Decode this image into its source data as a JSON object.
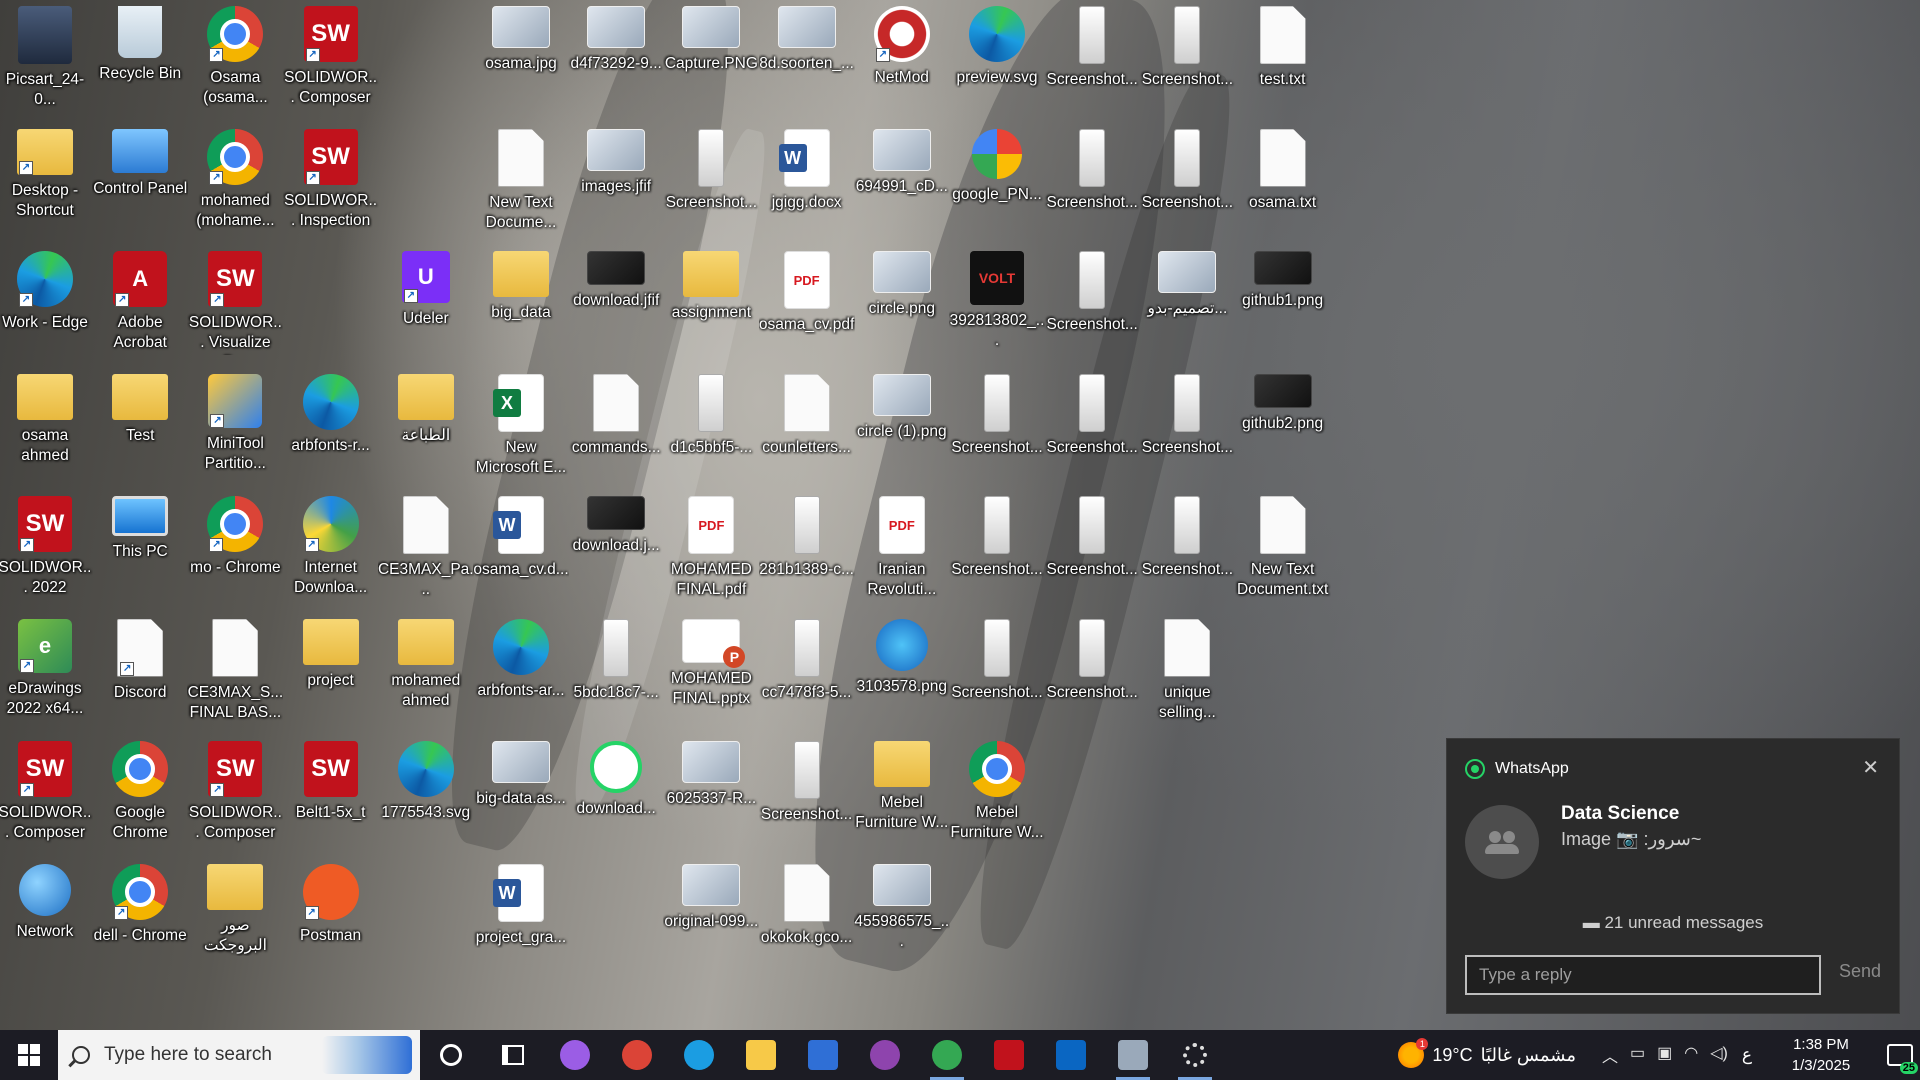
{
  "desktop": {
    "icons": [
      {
        "label": "Picsart_24-0...",
        "kind": "person",
        "col": 0,
        "row": 0
      },
      {
        "label": "Desktop - Shortcut",
        "kind": "folder",
        "col": 0,
        "row": 1,
        "shortcut": true
      },
      {
        "label": "Work - Edge",
        "kind": "edge",
        "col": 0,
        "row": 2,
        "shortcut": true
      },
      {
        "label": "osama ahmed",
        "kind": "folder",
        "col": 0,
        "row": 3
      },
      {
        "label": "SOLIDWOR... 2022",
        "kind": "sw",
        "col": 0,
        "row": 4,
        "shortcut": true
      },
      {
        "label": "eDrawings 2022 x64...",
        "kind": "edraw",
        "col": 0,
        "row": 5,
        "shortcut": true
      },
      {
        "label": "SOLIDWOR... Composer ...",
        "kind": "sw",
        "col": 0,
        "row": 6,
        "shortcut": true
      },
      {
        "label": "Network",
        "kind": "net",
        "col": 0,
        "row": 7
      },
      {
        "label": "Recycle Bin",
        "kind": "bin",
        "col": 1,
        "row": 0
      },
      {
        "label": "Control Panel",
        "kind": "cpanel",
        "col": 1,
        "row": 1
      },
      {
        "label": "Adobe Acrobat",
        "kind": "acrobat",
        "col": 1,
        "row": 2,
        "shortcut": true
      },
      {
        "label": "Test",
        "kind": "folder",
        "col": 1,
        "row": 3
      },
      {
        "label": "This PC",
        "kind": "pc",
        "col": 1,
        "row": 4
      },
      {
        "label": "Discord",
        "kind": "file",
        "col": 1,
        "row": 5,
        "shortcut": true
      },
      {
        "label": "Google Chrome",
        "kind": "chrome",
        "col": 1,
        "row": 6
      },
      {
        "label": "dell - Chrome",
        "kind": "chrome",
        "col": 1,
        "row": 7,
        "shortcut": true
      },
      {
        "label": "Osama (osama...",
        "kind": "chrome",
        "col": 2,
        "row": 0,
        "shortcut": true
      },
      {
        "label": "mohamed (mohame...",
        "kind": "chrome",
        "col": 2,
        "row": 1,
        "shortcut": true
      },
      {
        "label": "SOLIDWOR... Visualize B...",
        "kind": "sw",
        "col": 2,
        "row": 2,
        "shortcut": true
      },
      {
        "label": "MiniTool Partitio...",
        "kind": "minitool",
        "col": 2,
        "row": 3,
        "shortcut": true
      },
      {
        "label": "mo - Chrome",
        "kind": "chrome",
        "col": 2,
        "row": 4,
        "shortcut": true
      },
      {
        "label": "CE3MAX_S... FINAL BAS...",
        "kind": "file",
        "col": 2,
        "row": 5
      },
      {
        "label": "SOLIDWOR... Composer ...",
        "kind": "sw",
        "col": 2,
        "row": 6,
        "shortcut": true
      },
      {
        "label": "صور البروجكت",
        "kind": "folder",
        "col": 2,
        "row": 7
      },
      {
        "label": "SOLIDWOR... Composer ...",
        "kind": "sw",
        "col": 3,
        "row": 0,
        "shortcut": true
      },
      {
        "label": "SOLIDWOR... Inspection ...",
        "kind": "sw",
        "col": 3,
        "row": 1,
        "shortcut": true
      },
      {
        "label": "arbfonts-r...",
        "kind": "edge",
        "col": 3,
        "row": 3
      },
      {
        "label": "Internet Downloa...",
        "kind": "idm",
        "col": 3,
        "row": 4,
        "shortcut": true
      },
      {
        "label": "project",
        "kind": "folder",
        "col": 3,
        "row": 5
      },
      {
        "label": "Belt1-5x_t",
        "kind": "sw",
        "col": 3,
        "row": 6
      },
      {
        "label": "Postman",
        "kind": "postman",
        "col": 3,
        "row": 7,
        "shortcut": true
      },
      {
        "label": "Udeler",
        "kind": "udeler",
        "col": 4,
        "row": 2,
        "shortcut": true
      },
      {
        "label": "الطباعة",
        "kind": "folder",
        "col": 4,
        "row": 3
      },
      {
        "label": "CE3MAX_Pa...",
        "kind": "file",
        "col": 4,
        "row": 4
      },
      {
        "label": "mohamed ahmed",
        "kind": "folder",
        "col": 4,
        "row": 5
      },
      {
        "label": "1775543.svg",
        "kind": "edge",
        "col": 4,
        "row": 6
      },
      {
        "label": "osama.jpg",
        "kind": "image",
        "col": 5,
        "row": 0
      },
      {
        "label": "New Text Docume...",
        "kind": "file",
        "col": 5,
        "row": 1
      },
      {
        "label": "big_data",
        "kind": "folder",
        "col": 5,
        "row": 2
      },
      {
        "label": "New Microsoft E...",
        "kind": "excel",
        "col": 5,
        "row": 3
      },
      {
        "label": "osama_cv.d...",
        "kind": "word",
        "col": 5,
        "row": 4
      },
      {
        "label": "arbfonts-ar...",
        "kind": "edge",
        "col": 5,
        "row": 5
      },
      {
        "label": "big-data.as...",
        "kind": "image",
        "col": 5,
        "row": 6
      },
      {
        "label": "project_gra...",
        "kind": "word",
        "col": 5,
        "row": 7
      },
      {
        "label": "d4f73292-9...",
        "kind": "image",
        "col": 6,
        "row": 0
      },
      {
        "label": "images.jfif",
        "kind": "image",
        "col": 6,
        "row": 1
      },
      {
        "label": "download.jfif",
        "kind": "image-dark",
        "col": 6,
        "row": 2
      },
      {
        "label": "commands...",
        "kind": "file",
        "col": 6,
        "row": 3
      },
      {
        "label": "download.j...",
        "kind": "image-dark",
        "col": 6,
        "row": 4
      },
      {
        "label": "5bdc18c7-...",
        "kind": "phone",
        "col": 6,
        "row": 5
      },
      {
        "label": "download...",
        "kind": "whats",
        "col": 6,
        "row": 6
      },
      {
        "label": "Capture.PNG",
        "kind": "image",
        "col": 7,
        "row": 0
      },
      {
        "label": "Screenshot...",
        "kind": "phone",
        "col": 7,
        "row": 1
      },
      {
        "label": "assignment",
        "kind": "folder",
        "col": 7,
        "row": 2
      },
      {
        "label": "d1c5bbf5-...",
        "kind": "phone",
        "col": 7,
        "row": 3
      },
      {
        "label": "MOHAMED FINAL.pdf",
        "kind": "pdf",
        "col": 7,
        "row": 4
      },
      {
        "label": "MOHAMED FINAL.pptx",
        "kind": "ppt",
        "col": 7,
        "row": 5
      },
      {
        "label": "6025337-R...",
        "kind": "image",
        "col": 7,
        "row": 6
      },
      {
        "label": "original-099...",
        "kind": "image",
        "col": 7,
        "row": 7
      },
      {
        "label": "8d.soorten_...",
        "kind": "image",
        "col": 8,
        "row": 0
      },
      {
        "label": "jgigg.docx",
        "kind": "word",
        "col": 8,
        "row": 1
      },
      {
        "label": "osama_cv.pdf",
        "kind": "pdf",
        "col": 8,
        "row": 2
      },
      {
        "label": "counletters...",
        "kind": "file",
        "col": 8,
        "row": 3
      },
      {
        "label": "281b1389-c...",
        "kind": "phone",
        "col": 8,
        "row": 4
      },
      {
        "label": "cc7478f3-5...",
        "kind": "phone",
        "col": 8,
        "row": 5
      },
      {
        "label": "Screenshot...",
        "kind": "phone",
        "col": 8,
        "row": 6
      },
      {
        "label": "okokok.gco...",
        "kind": "file",
        "col": 8,
        "row": 7
      },
      {
        "label": "NetMod",
        "kind": "netmod",
        "col": 9,
        "row": 0,
        "shortcut": true
      },
      {
        "label": "694991_cD...",
        "kind": "image",
        "col": 9,
        "row": 1
      },
      {
        "label": "circle.png",
        "kind": "image",
        "col": 9,
        "row": 2
      },
      {
        "label": "circle (1).png",
        "kind": "image",
        "col": 9,
        "row": 3
      },
      {
        "label": "Iranian Revoluti...",
        "kind": "pdf",
        "col": 9,
        "row": 4
      },
      {
        "label": "3103578.png",
        "kind": "flash",
        "col": 9,
        "row": 5
      },
      {
        "label": "Mebel Furniture W...",
        "kind": "folder",
        "col": 9,
        "row": 6
      },
      {
        "label": "455986575_...",
        "kind": "image",
        "col": 9,
        "row": 7
      },
      {
        "label": "preview.svg",
        "kind": "edge",
        "col": 10,
        "row": 0
      },
      {
        "label": "google_PN...",
        "kind": "google",
        "col": 10,
        "row": 1
      },
      {
        "label": "392813802_...",
        "kind": "volt",
        "col": 10,
        "row": 2
      },
      {
        "label": "Screenshot...",
        "kind": "phone",
        "col": 10,
        "row": 3
      },
      {
        "label": "Screenshot...",
        "kind": "phone",
        "col": 10,
        "row": 4
      },
      {
        "label": "Screenshot...",
        "kind": "phone",
        "col": 10,
        "row": 5
      },
      {
        "label": "Mebel Furniture W...",
        "kind": "chrome",
        "col": 10,
        "row": 6
      },
      {
        "label": "Screenshot...",
        "kind": "phone",
        "col": 11,
        "row": 0
      },
      {
        "label": "Screenshot...",
        "kind": "phone",
        "col": 11,
        "row": 1
      },
      {
        "label": "Screenshot...",
        "kind": "phone",
        "col": 11,
        "row": 2
      },
      {
        "label": "Screenshot...",
        "kind": "phone",
        "col": 11,
        "row": 3
      },
      {
        "label": "Screenshot...",
        "kind": "phone",
        "col": 11,
        "row": 4
      },
      {
        "label": "Screenshot...",
        "kind": "phone",
        "col": 11,
        "row": 5
      },
      {
        "label": "Screenshot...",
        "kind": "phone",
        "col": 12,
        "row": 0
      },
      {
        "label": "Screenshot...",
        "kind": "phone",
        "col": 12,
        "row": 1
      },
      {
        "label": "تصميم-بدو...",
        "kind": "image",
        "col": 12,
        "row": 2
      },
      {
        "label": "Screenshot...",
        "kind": "phone",
        "col": 12,
        "row": 3
      },
      {
        "label": "Screenshot...",
        "kind": "phone",
        "col": 12,
        "row": 4
      },
      {
        "label": "unique selling...",
        "kind": "file",
        "col": 12,
        "row": 5
      },
      {
        "label": "test.txt",
        "kind": "file",
        "col": 13,
        "row": 0
      },
      {
        "label": "osama.txt",
        "kind": "file",
        "col": 13,
        "row": 1
      },
      {
        "label": "github1.png",
        "kind": "image-dark",
        "col": 13,
        "row": 2
      },
      {
        "label": "github2.png",
        "kind": "image-dark",
        "col": 13,
        "row": 3
      },
      {
        "label": "New Text Document.txt",
        "kind": "file",
        "col": 13,
        "row": 4
      }
    ]
  },
  "notification": {
    "app_name": "WhatsApp",
    "app_icon": "whatsapp-icon",
    "close_icon": "close-icon",
    "sender": "Data Science",
    "message": "Image 📷 :سرور~",
    "unread": "▬ 21 unread messages",
    "reply_placeholder": "Type a reply",
    "send_label": "Send"
  },
  "taskbar": {
    "search_placeholder": "Type here to search",
    "apps": [
      {
        "name": "cortana",
        "icon": "cortana-icon"
      },
      {
        "name": "task-view",
        "icon": "task-view-icon"
      },
      {
        "name": "copilot",
        "icon": "copilot-icon",
        "color": "#9b5de5"
      },
      {
        "name": "chrome",
        "icon": "chrome-icon",
        "color": "#db4437"
      },
      {
        "name": "edge",
        "icon": "edge-icon",
        "color": "#1b9de2"
      },
      {
        "name": "file-explorer",
        "icon": "folder-icon",
        "color": "#f7c948"
      },
      {
        "name": "microsoft-store",
        "icon": "store-icon",
        "color": "#2f6fd6"
      },
      {
        "name": "media-player",
        "icon": "play-icon",
        "color": "#8e44ad"
      },
      {
        "name": "chrome-profile",
        "icon": "chrome-icon",
        "color": "#34a853",
        "active": true
      },
      {
        "name": "acrobat",
        "icon": "acrobat-icon",
        "color": "#c1121c"
      },
      {
        "name": "outlook",
        "icon": "outlook-icon",
        "color": "#0a66c2"
      },
      {
        "name": "snipping",
        "icon": "snip-icon",
        "color": "#9aa9ba",
        "active": true
      },
      {
        "name": "settings",
        "icon": "gear-icon",
        "color": "#cccccc",
        "active": true
      }
    ],
    "weather": {
      "temp": "19°C",
      "desc": "مشمس غالبًا",
      "badge": "1"
    },
    "language": "ع",
    "time": "1:38 PM",
    "date": "1/3/2025",
    "notif_count": "25"
  }
}
